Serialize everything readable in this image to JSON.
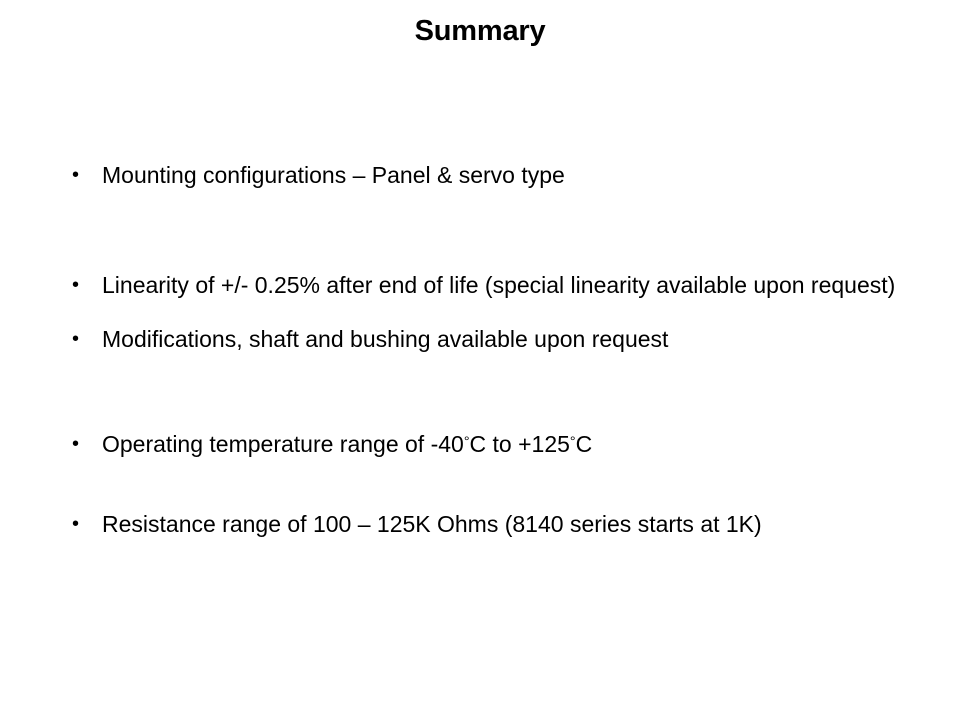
{
  "slide": {
    "title": "Summary",
    "background_color": "#ffffff",
    "text_color": "#000000",
    "bullet_glyph": "•",
    "bullets": [
      {
        "id": "mounting-configurations",
        "text": "Mounting configurations – Panel & servo type"
      },
      {
        "id": "linearity",
        "text": "Linearity of +/- 0.25% after end of life (special linearity available upon request)"
      },
      {
        "id": "modifications",
        "text": "Modifications, shaft and bushing available upon request"
      },
      {
        "id": "operating-temperature",
        "text_before_first_degree": "Operating temperature range of -40",
        "degree_symbol": "°",
        "text_middle": "C to +125",
        "text_after_second_degree": "C",
        "full_text": "Operating temperature range of -40°C to +125°C"
      },
      {
        "id": "resistance-range",
        "text": "Resistance range of 100 – 125K Ohms (8140 series starts at 1K)"
      }
    ]
  }
}
